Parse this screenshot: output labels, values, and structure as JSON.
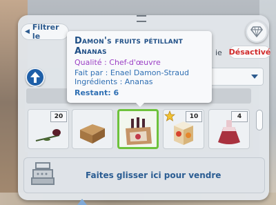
{
  "filter": {
    "label": "Filtrer le"
  },
  "toggle": {
    "label_partial": "ie",
    "status": "Désactivé"
  },
  "tooltip": {
    "title_line1": "Damon's fruits pétillant",
    "title_line2": "Ananas",
    "quality": "Qualité  : Chef-d'œuvre",
    "maker": "Fait par  : Enael Damon-Straud",
    "ingredients": "Ingrédients  : Ananas",
    "remaining": "Restant: 6"
  },
  "items": [
    {
      "name": "rose-item",
      "count": "20",
      "icon": "rose-icon"
    },
    {
      "name": "crate-item",
      "count": "",
      "icon": "crate-icon"
    },
    {
      "name": "wine-case-item",
      "count": "",
      "icon": "wine-case-icon",
      "selected": true
    },
    {
      "name": "juice-carton-item",
      "count": "10",
      "icon": "juice-carton-icon",
      "starred": true
    },
    {
      "name": "potion-item",
      "count": "4",
      "icon": "potion-icon"
    }
  ],
  "sell": {
    "label": "Faites glisser ici pour vendre"
  },
  "colors": {
    "accent_blue": "#1e5fa8",
    "status_red": "#d12a2a",
    "quality_purple": "#9b3fc4",
    "selected_green": "#6dc23b"
  }
}
